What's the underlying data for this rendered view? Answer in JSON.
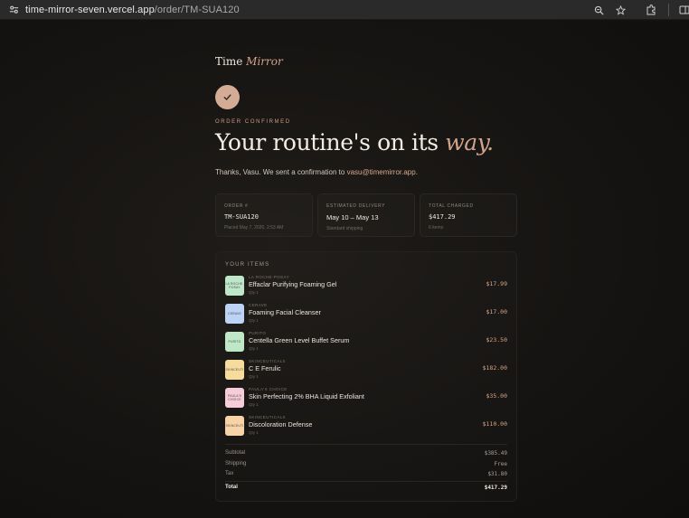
{
  "browser": {
    "url_host": "time-mirror-seven.vercel.app",
    "url_path": "/order/TM-SUA120",
    "icons": [
      "site-settings-icon",
      "zoom-icon",
      "star-icon",
      "extensions-icon",
      "sidebar-icon"
    ]
  },
  "brand": {
    "word1": "Time",
    "word2": "Mirror"
  },
  "eyebrow": "ORDER CONFIRMED",
  "headline": {
    "main": "Your routine's on its ",
    "accent": "way."
  },
  "thanks": {
    "before": "Thanks, Vasu. We sent a confirmation to ",
    "email": "vasu@timemirror.app",
    "after": "."
  },
  "cards": [
    {
      "label": "ORDER #",
      "value": "TM-SUA120",
      "sub": "Placed May 7, 2026, 2:53 AM"
    },
    {
      "label": "ESTIMATED DELIVERY",
      "value": "May 10 – May 13",
      "sub": "Standard shipping"
    },
    {
      "label": "TOTAL CHARGED",
      "value": "$417.29",
      "sub": "6 items"
    }
  ],
  "items_title": "YOUR ITEMS",
  "items": [
    {
      "brand": "LA ROCHE-POSAY",
      "thumb": "LA ROCHE-POSAY",
      "name": "Effaclar Purifying Foaming Gel",
      "qty": "Qty 1",
      "price": "$17.99",
      "color": "#bde7c8"
    },
    {
      "brand": "CERAVE",
      "thumb": "CERAVE",
      "name": "Foaming Facial Cleanser",
      "qty": "Qty 1",
      "price": "$17.00",
      "color": "#bcd3f5"
    },
    {
      "brand": "PURITO",
      "thumb": "PURITO",
      "name": "Centella Green Level Buffet Serum",
      "qty": "Qty 1",
      "price": "$23.50",
      "color": "#bfe8c7"
    },
    {
      "brand": "SKINCEUTICALS",
      "thumb": "SKINCEUTI",
      "name": "C E Ferulic",
      "qty": "Qty 1",
      "price": "$182.00",
      "color": "#f6dc9c"
    },
    {
      "brand": "PAULA'S CHOICE",
      "thumb": "PAULA'S CHOICE",
      "name": "Skin Perfecting 2% BHA Liquid Exfoliant",
      "qty": "Qty 1",
      "price": "$35.00",
      "color": "#f6ccd8"
    },
    {
      "brand": "SKINCEUTICALS",
      "thumb": "SKINCEUTI",
      "name": "Discoloration Defense",
      "qty": "Qty 1",
      "price": "$110.00",
      "color": "#f8d3a8"
    }
  ],
  "summary": [
    {
      "label": "Subtotal",
      "value": "$385.49"
    },
    {
      "label": "Shipping",
      "value": "Free"
    },
    {
      "label": "Tax",
      "value": "$31.80"
    }
  ],
  "total": {
    "label": "Total",
    "value": "$417.29"
  }
}
